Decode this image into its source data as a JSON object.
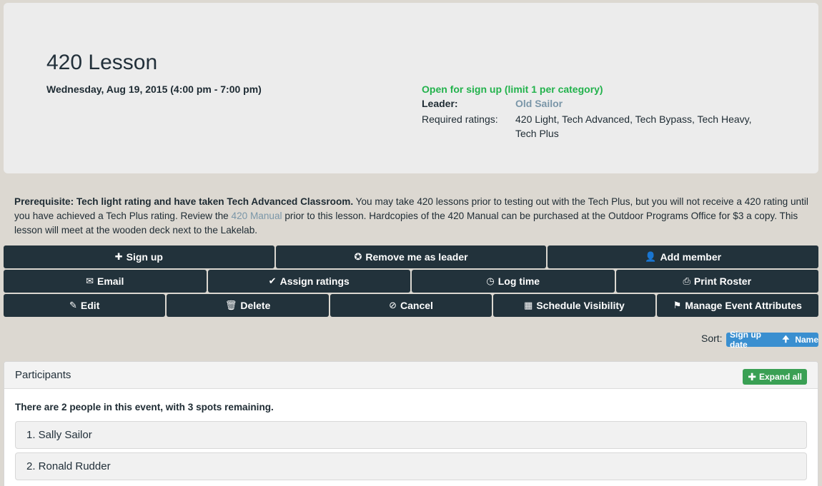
{
  "event": {
    "title": "420 Lesson",
    "date": "Wednesday, Aug 19, 2015 (4:00 pm - 7:00 pm)",
    "status": "Open for sign up (limit 1 per category)",
    "leader_label": "Leader:",
    "leader_name": "Old Sailor",
    "ratings_label": "Required ratings:",
    "ratings_value": "420 Light, Tech Advanced, Tech Bypass, Tech Heavy, Tech Plus"
  },
  "description": {
    "prereq": "Prerequisite: Tech light rating and have taken Tech Advanced Classroom.",
    "text_before_link": "  You may take 420 lessons prior to testing out with the Tech Plus, but you will not receive a 420 rating until you have achieved a Tech Plus rating. Review the ",
    "link_text": "420 Manual",
    "text_after_link": " prior to this lesson. Hardcopies of the 420 Manual can be purchased at the Outdoor Programs Office for $3 a copy. This lesson will meet at the wooden deck next to the Lakelab."
  },
  "actions": {
    "row1": [
      {
        "label": "Sign up",
        "icon": "plus-icon",
        "glyph": "✚"
      },
      {
        "label": "Remove me as leader",
        "icon": "remove-circle-icon",
        "glyph": "✪"
      },
      {
        "label": "Add member",
        "icon": "user-icon",
        "glyph": "👤"
      }
    ],
    "row2": [
      {
        "label": "Email",
        "icon": "envelope-icon",
        "glyph": "✉"
      },
      {
        "label": "Assign ratings",
        "icon": "check-icon",
        "glyph": "✔"
      },
      {
        "label": "Log time",
        "icon": "clock-icon",
        "glyph": "◷"
      },
      {
        "label": "Print Roster",
        "icon": "print-icon",
        "glyph": "⎙"
      }
    ],
    "row3": [
      {
        "label": "Edit",
        "icon": "edit-icon",
        "glyph": "✎"
      },
      {
        "label": "Delete",
        "icon": "trash-icon",
        "glyph": "🗑"
      },
      {
        "label": "Cancel",
        "icon": "ban-icon",
        "glyph": "⊘"
      },
      {
        "label": "Schedule Visibility",
        "icon": "calendar-icon",
        "glyph": "▦"
      },
      {
        "label": "Manage Event Attributes",
        "icon": "flag-icon",
        "glyph": "⚑"
      }
    ]
  },
  "sort": {
    "label": "Sort:",
    "option1": "Sign up date",
    "arrow": "🠉",
    "option2": "Name"
  },
  "participants": {
    "title": "Participants",
    "expand_label": "Expand all",
    "summary": "There are 2 people in this event, with 3 spots remaining.",
    "people": [
      "1. Sally Sailor",
      "2. Ronald Rudder"
    ]
  },
  "colors": {
    "button_bg": "#22323b",
    "status_green": "#22b24c",
    "link_blue": "#7a96a8",
    "sort_blue": "#3a8fd0",
    "expand_green": "#3aa054"
  }
}
